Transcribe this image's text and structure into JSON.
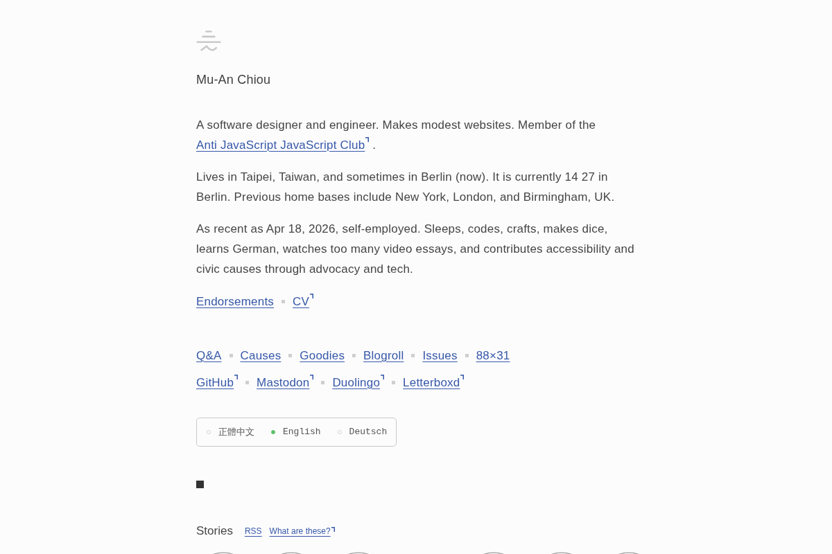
{
  "header": {
    "name": "Mu-An Chiou"
  },
  "bio": [
    {
      "parts": [
        {
          "kind": "text",
          "text": "A software designer and engineer. Makes modest websites. Member of the"
        },
        {
          "kind": "link",
          "text": "Anti JavaScript JavaScript Club",
          "external": true
        },
        {
          "kind": "text",
          "text": "."
        }
      ]
    },
    {
      "parts": [
        {
          "kind": "text",
          "text": "Lives in Taipei, Taiwan, and sometimes in Berlin (now). It is currently 14 27 in Berlin. Previous home bases include New York, London, and Birmingham, UK."
        }
      ]
    },
    {
      "parts": [
        {
          "kind": "text",
          "text": "As recent as Apr 18, 2026, self-employed. Sleeps, codes, crafts, makes dice, learns German, watches too many video essays, and contributes accessibility and civic causes through advocacy and tech."
        }
      ]
    }
  ],
  "primary_links": [
    {
      "label": "Endorsements",
      "external": false
    },
    {
      "label": "CV",
      "external": true
    }
  ],
  "nav_rows": [
    {
      "links": [
        {
          "label": "Q&A",
          "external": false
        },
        {
          "label": "Causes",
          "external": false
        },
        {
          "label": "Goodies",
          "external": false
        },
        {
          "label": "Blogroll",
          "external": false
        },
        {
          "label": "Issues",
          "external": false
        },
        {
          "label": "88×31",
          "external": false
        }
      ]
    },
    {
      "links": [
        {
          "label": "GitHub",
          "external": true
        },
        {
          "label": "Mastodon",
          "external": true
        },
        {
          "label": "Duolingo",
          "external": true
        },
        {
          "label": "Letterboxd",
          "external": true
        }
      ]
    }
  ],
  "languages": [
    {
      "label": "正體中文",
      "selected": false
    },
    {
      "label": "English",
      "selected": true
    },
    {
      "label": "Deutsch",
      "selected": false
    }
  ],
  "stories": {
    "title": "Stories",
    "links": [
      {
        "label": "RSS",
        "external": false
      },
      {
        "label": "What are these?",
        "external": true
      }
    ]
  }
}
